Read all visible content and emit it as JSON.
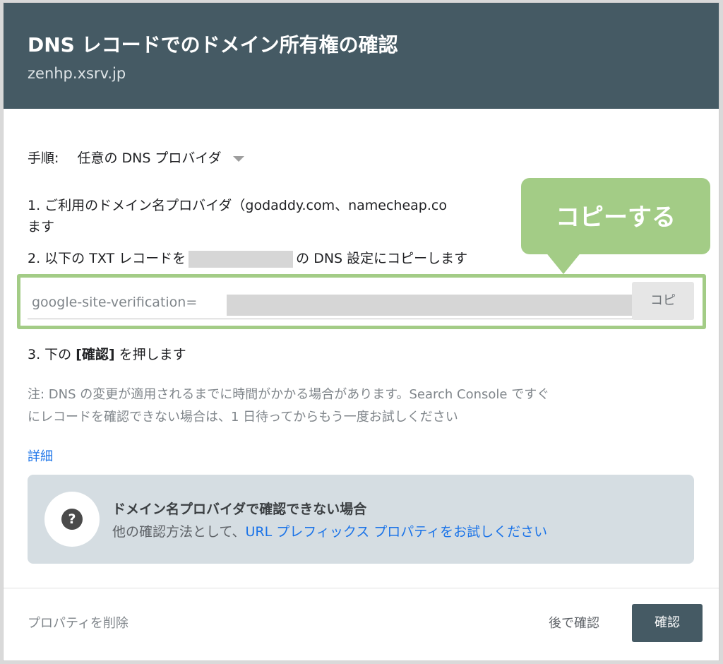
{
  "header": {
    "title": "DNS レコードでのドメイン所有権の確認",
    "subtitle": "zenhp.xsrv.jp"
  },
  "method": {
    "label": "手順:",
    "value": "任意の DNS プロバイダ"
  },
  "steps": {
    "step1": "1. ご利用のドメイン名プロバイダ（godaddy.com、namecheap.co",
    "step1_cont": "ます",
    "step2_prefix": "2. 以下の TXT レコードを",
    "step2_suffix": "の DNS 設定にコピーします",
    "step3_prefix": "3. 下の ",
    "step3_bold": "[確認]",
    "step3_suffix": " を押します"
  },
  "txt_record": {
    "value": "google-site-verification=",
    "copy_label": "コピ"
  },
  "note": {
    "line1": "注: DNS の変更が適用されるまでに時間がかかる場合があります。Search Console ですぐ",
    "line2": "にレコードを確認できない場合は、1 日待ってからもう一度お試しください"
  },
  "details_link": "詳細",
  "info": {
    "title": "ドメイン名プロバイダで確認できない場合",
    "desc_prefix": "他の確認方法として、",
    "desc_link": "URL プレフィックス プロパティをお試しください"
  },
  "footer": {
    "delete_label": "プロパティを削除",
    "later_label": "後で確認",
    "verify_label": "確認"
  },
  "callout": {
    "text": "コピーする"
  },
  "colors": {
    "header_bg": "#455a64",
    "highlight_green": "#a3cc86",
    "link_blue": "#1a73e8"
  }
}
